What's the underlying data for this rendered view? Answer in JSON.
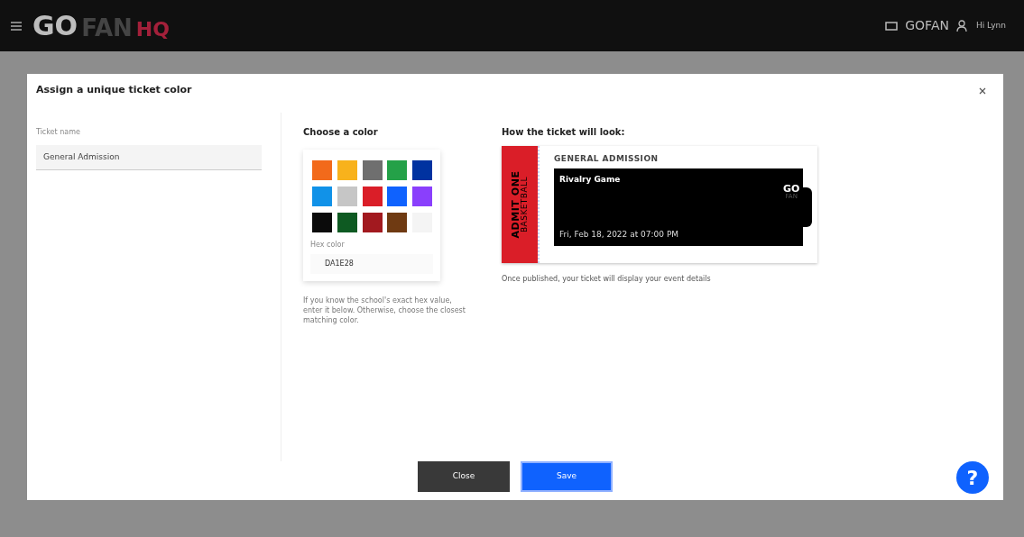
{
  "top_bar": {
    "logo_text": "GO",
    "logo_sub": "FAN",
    "logo_hq": "HQ",
    "org": "GOFAN",
    "greeting": "Hi Lynn"
  },
  "modal": {
    "title": "Assign a unique ticket color",
    "ticket_name": {
      "label": "Ticket name",
      "value": "General Admission"
    },
    "color_picker": {
      "heading": "Choose a color",
      "swatches": [
        {
          "kind": "color",
          "color": "#f26a1b"
        },
        {
          "kind": "color",
          "color": "#f8b21c"
        },
        {
          "kind": "color",
          "color": "#6f6f6f"
        },
        {
          "kind": "color",
          "color": "#24a148"
        },
        {
          "kind": "color",
          "color": "#0032a0"
        },
        {
          "kind": "color",
          "color": "#1192e8"
        },
        {
          "kind": "color",
          "color": "#c6c6c6"
        },
        {
          "kind": "color",
          "color": "#da1e28"
        },
        {
          "kind": "color",
          "color": "#0f62fe"
        },
        {
          "kind": "color",
          "color": "#8a3ffc"
        },
        {
          "kind": "color",
          "color": "#0b0b0b"
        },
        {
          "kind": "color",
          "color": "#0e5a22"
        },
        {
          "kind": "color",
          "color": "#a2191f"
        },
        {
          "kind": "color",
          "color": "#6f3a12"
        },
        {
          "kind": "none"
        }
      ],
      "hex_label": "Hex color",
      "hex_value": "DA1E28",
      "help": "If you know the school's exact hex value, enter it below. Otherwise, choose the closest matching color."
    },
    "preview": {
      "heading": "How the ticket will look:",
      "color": "#da1e28",
      "stub_line1": "ADMIT ONE",
      "stub_line2": "BASKETBALL",
      "ticket_type": "GENERAL ADMISSION",
      "event": "Rivalry Game",
      "date": "Fri, Feb 18, 2022 at 07:00 PM",
      "logo": "GO",
      "logo_sub": "FAN",
      "note": "Once published, your ticket will display your event details"
    },
    "buttons": [
      {
        "label": "Close",
        "kind": "secondary"
      },
      {
        "label": "Save",
        "kind": "primary"
      }
    ]
  },
  "help_button": "?"
}
